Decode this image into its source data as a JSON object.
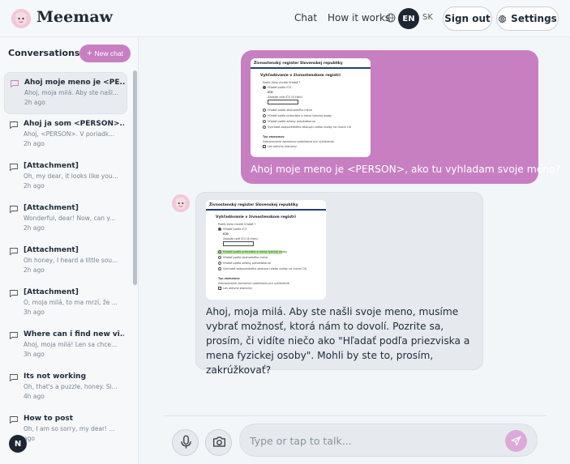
{
  "header": {
    "brand": "Meemaw",
    "nav": {
      "chat": "Chat",
      "how": "How it works"
    },
    "lang": {
      "en": "EN",
      "sk": "SK",
      "icon": "globe-icon"
    },
    "sign_out": "Sign out",
    "settings": "Settings"
  },
  "sidebar": {
    "title": "Conversations",
    "new_chat": "New chat",
    "items": [
      {
        "title": "Ahoj moje meno je <PE...",
        "preview": "Ahoj, moja milá. Aby ste našl...",
        "time": "2h ago"
      },
      {
        "title": "Ahoj ja som <PERSON>...",
        "preview": "Ahoj, <PERSON>. V poriadk...",
        "time": "2h ago"
      },
      {
        "title": "[Attachment]",
        "preview": "Oh, my dear, it looks like you...",
        "time": "2h ago"
      },
      {
        "title": "[Attachment]",
        "preview": "Wonderful, dear! Now, can y...",
        "time": "2h ago"
      },
      {
        "title": "[Attachment]",
        "preview": "Oh honey, I heard a little sou...",
        "time": "2h ago"
      },
      {
        "title": "[Attachment]",
        "preview": "Ó, moja milá, to ma mrzí, že ...",
        "time": "3h ago"
      },
      {
        "title": "Where can i find new vi...",
        "preview": "Ahoj, moja milá! Len sa chce...",
        "time": "3h ago"
      },
      {
        "title": "Its not working",
        "preview": "Oh, that's a puzzle, honey. Si...",
        "time": "4h ago"
      },
      {
        "title": "How to post",
        "preview": "Oh, I am so sorry, my dear! ...",
        "time": "ago"
      }
    ],
    "badge": "N"
  },
  "chat": {
    "user_message": "Ahoj moje meno je <PERSON>, ako tu vyhladam svoje meno?",
    "bot_message": "Ahoj, moja milá. Aby ste našli svoje meno, musíme vybrať možnosť, ktorá nám to dovolí. Pozrite sa, prosím, či vidíte niečo ako \"Hľadať podľa priezviska a mena fyzickej osoby\". Mohli by ste to, prosím, zakrúžkovať?",
    "doc": {
      "header": "Živnostenský register Slovenskej republiky",
      "title": "Vyhľadávanie v živnostenskom registri",
      "prompt": "Podľa čoho chcete hľadať ?",
      "opt1": "Hľadať podľa IČO",
      "ico_label": "IČO",
      "ico_hint": "Zadajte celé IČO (8 číslic)",
      "opt2": "Hľadať podľa obchodného mena",
      "opt3": "Hľadať podľa priezviska a mena fyzickej osoby",
      "opt4": "Hľadať podľa adresy prevádzkarne",
      "opt5": "Vyhľadať zodpovedného zástupcu alebo služby na úrovni OÚ",
      "type_label": "Typ záznamov",
      "type_hint": "Zobrazovanie zaznamov podnikania pre vyhľadanie",
      "check": "Len aktívne záznamy"
    },
    "input_placeholder": "Type or tap to talk..."
  }
}
